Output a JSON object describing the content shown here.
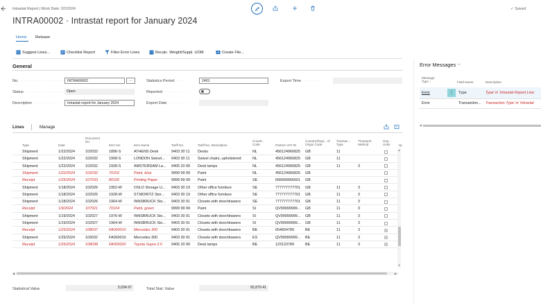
{
  "header": {
    "breadcrumb": "Intrastat Report | Work Date: 2/2/2024",
    "title": "INTRA00002 · Intrastat report for January 2024",
    "saved_label": "Saved"
  },
  "tabs": {
    "home": "Home",
    "release": "Release"
  },
  "toolbar": {
    "suggest_lines": "Suggest Lines...",
    "checklist_report": "Checklist Report",
    "filter_error_lines": "Filter Error Lines",
    "recalc": "Recalc. Weight/Suppl. UOM",
    "create_file": "Create File..."
  },
  "general": {
    "heading": "General",
    "no_label": "No.",
    "no_value": "INTRA00002",
    "status_label": "Status",
    "status_value": "Open",
    "description_label": "Description",
    "description_value": "Intrastat report for January 2024",
    "statistics_period_label": "Statistics Period",
    "statistics_period_value": "2401",
    "reported_label": "Reported",
    "export_date_label": "Export Date",
    "export_time_label": "Export Time"
  },
  "lines": {
    "tab_lines": "Lines",
    "tab_manage": "Manage",
    "columns": {
      "type": "Type",
      "date": "Date",
      "document_no": "Document No.",
      "item_no": "Item No.",
      "item_name": "Item Name",
      "tariff_no": "Tariff No.",
      "tariff_desc": "Tariff No. Description",
      "country_code": "Countr... Code",
      "partner_vat": "Partner VAT ID",
      "country_origin": "Country/Regi... of Origin Code",
      "transaction_type": "Transac... Type",
      "transport_method": "Transport Method",
      "supp_units": "Sup... Units",
      "extra": "Qu"
    },
    "rows": [
      {
        "type": "Shipment",
        "date": "1/22/2024",
        "doc": "102032",
        "item": "1896-S",
        "name": "ATHENS Desk",
        "tariff": "9403 30 11",
        "desc": "Desks",
        "country": "NL",
        "vat": "456124966825",
        "origin": "GB",
        "ttype": "11",
        "tmethod": "",
        "supp": false,
        "error": false
      },
      {
        "type": "Shipment",
        "date": "1/22/2024",
        "doc": "102032",
        "item": "1908-S",
        "name": "LONDON Swivel...",
        "tariff": "9403 30 11",
        "desc": "Swivel chairs, upholstered",
        "country": "NL",
        "vat": "456124966825",
        "origin": "GB",
        "ttype": "11",
        "tmethod": "",
        "supp": false,
        "error": false
      },
      {
        "type": "Shipment",
        "date": "1/22/2024",
        "doc": "102032",
        "item": "1928-S",
        "name": "AMSTERDAM La...",
        "tariff": "9405 20 99",
        "desc": "Desk lamps",
        "country": "NL",
        "vat": "456124966825",
        "origin": "GB",
        "ttype": "11",
        "tmethod": "3",
        "supp": false,
        "error": false
      },
      {
        "type": "Shipment",
        "date": "1/22/2024",
        "doc": "102032",
        "item": "70102",
        "name": "Paint, blue",
        "tariff": "9999 99 99",
        "desc": "Paint",
        "country": "NL",
        "vat": "456124966825",
        "origin": "GB",
        "ttype": "",
        "tmethod": "",
        "supp": false,
        "error": true
      },
      {
        "type": "Receipt",
        "date": "1/25/2024",
        "doc": "107033",
        "item": "80100",
        "name": "Printing Paper",
        "tariff": "9999 99 99",
        "desc": "Paint",
        "country": "SE",
        "vat": "666666666601",
        "origin": "GB",
        "ttype": "",
        "tmethod": "",
        "supp": false,
        "error": true
      },
      {
        "type": "Shipment",
        "date": "1/18/2024",
        "doc": "102026",
        "item": "1952-W",
        "name": "OSLO Storage U...",
        "tariff": "9403 30 19",
        "desc": "Other office furniture",
        "country": "SE",
        "vat": "777777777701",
        "origin": "GB",
        "ttype": "11",
        "tmethod": "3",
        "supp": false,
        "error": false
      },
      {
        "type": "Shipment",
        "date": "1/18/2024",
        "doc": "102026",
        "item": "1928-W",
        "name": "ST.MORITZ Stor...",
        "tariff": "9403 30 19",
        "desc": "Other office furniture",
        "country": "SE",
        "vat": "777777777701",
        "origin": "GB",
        "ttype": "11",
        "tmethod": "3",
        "supp": false,
        "error": false
      },
      {
        "type": "Shipment",
        "date": "1/18/2024",
        "doc": "102026",
        "item": "1964-W",
        "name": "INNSBRUCK Sto...",
        "tariff": "9403 30 91",
        "desc": "Closets with door/drawers",
        "country": "SE",
        "vat": "777777777701",
        "origin": "GB",
        "ttype": "11",
        "tmethod": "3",
        "supp": false,
        "error": false
      },
      {
        "type": "Receipt",
        "date": "1/9/2024",
        "doc": "107021",
        "item": "70104",
        "name": "Paint, green",
        "tariff": "9999 99 99",
        "desc": "Paint",
        "country": "SI",
        "vat": "QV99999999...",
        "origin": "GB",
        "ttype": "11",
        "tmethod": "3",
        "supp": false,
        "error": true
      },
      {
        "type": "Shipment",
        "date": "1/19/2024",
        "doc": "102027",
        "item": "1976-W",
        "name": "INNSBRUCK Sto...",
        "tariff": "9403 30 91",
        "desc": "Closets with door/drawers",
        "country": "SI",
        "vat": "QV99999999...",
        "origin": "GB",
        "ttype": "11",
        "tmethod": "3",
        "supp": false,
        "error": false
      },
      {
        "type": "Shipment",
        "date": "1/19/2024",
        "doc": "102027",
        "item": "1964-W",
        "name": "INNSBRUCK Sto...",
        "tariff": "9403 30 91",
        "desc": "Closets with door/drawers",
        "country": "SI",
        "vat": "QV99999999...",
        "origin": "GB",
        "ttype": "11",
        "tmethod": "3",
        "supp": false,
        "error": false
      },
      {
        "type": "Receipt",
        "date": "1/25/2024",
        "doc": "108037",
        "item": "FA000010",
        "name": "Mercedes 300",
        "tariff": "9403 30 91",
        "desc": "Closets with door/drawers",
        "country": "BE",
        "vat": "654654789",
        "origin": "BE",
        "ttype": "11",
        "tmethod": "3",
        "supp": true,
        "error": true
      },
      {
        "type": "Shipment",
        "date": "1/25/2024",
        "doc": "103032",
        "item": "FA000010",
        "name": "Mercedes 300",
        "tariff": "9403 30 91",
        "desc": "Closets with door/drawers",
        "country": "ES",
        "vat": "QV99999999...",
        "origin": "BE",
        "ttype": "11",
        "tmethod": "3",
        "supp": true,
        "error": false
      },
      {
        "type": "Receipt",
        "date": "1/25/2024",
        "doc": "108038",
        "item": "FA000020",
        "name": "Toyota Supra 3.0",
        "tariff": "9405 20 99",
        "desc": "Desk lamps",
        "country": "BE",
        "vat": "123123789",
        "origin": "BE",
        "ttype": "11",
        "tmethod": "3",
        "supp": true,
        "error": true
      }
    ]
  },
  "footer": {
    "statistical_value_label": "Statistical Value",
    "statistical_value": "3,034.97",
    "total_stat_value_label": "Total Stat. Value",
    "total_stat_value": "92,879.41"
  },
  "errors": {
    "heading": "Error Messages",
    "col_message_type": "Message Type ↑",
    "col_field_name": "Field Name",
    "col_description": "Description",
    "rows": [
      {
        "type": "Error",
        "field": "Type",
        "description": "Type' in 'Intrastat Report Line:"
      },
      {
        "type": "Error",
        "field": "Transaction...",
        "description": "Transaction Type' in 'Intrastat"
      }
    ]
  },
  "colors": {
    "accent": "#1f6fbf",
    "error_red": "#c62828",
    "teal": "#00b7c3"
  }
}
